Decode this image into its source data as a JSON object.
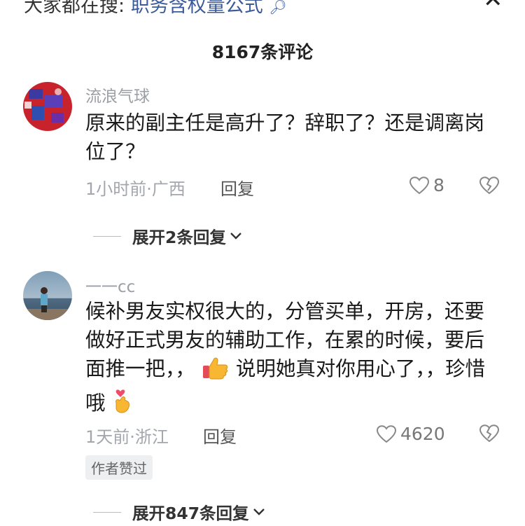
{
  "topbar": {
    "search_prefix": "大家都在搜:",
    "search_keyword": "职务含权量公式",
    "search_icon": "search-icon",
    "close_icon": "close-icon"
  },
  "header": {
    "title": "8167条评论"
  },
  "comments": [
    {
      "username": "流浪气球",
      "text": "原来的副主任是高升了？辞职了？还是调离岗位了？",
      "time_location": "1小时前·广西",
      "reply_label": "回复",
      "likes": "8",
      "expand_label": "展开2条回复"
    },
    {
      "username": "一一cc",
      "text_part1": "候补男友实权很大的，分管买单，开房，还要做好正式男友的辅助工作，在累的时候，要后面推一把，，",
      "text_part2": "说明她真对你用心了，，珍惜哦",
      "time_location": "1天前·浙江",
      "reply_label": "回复",
      "likes": "4620",
      "badge": "作者赞过",
      "expand_label": "展开847条回复"
    }
  ],
  "colors": {
    "accent_link": "#3b5a9a",
    "muted": "#a3a7ad"
  }
}
